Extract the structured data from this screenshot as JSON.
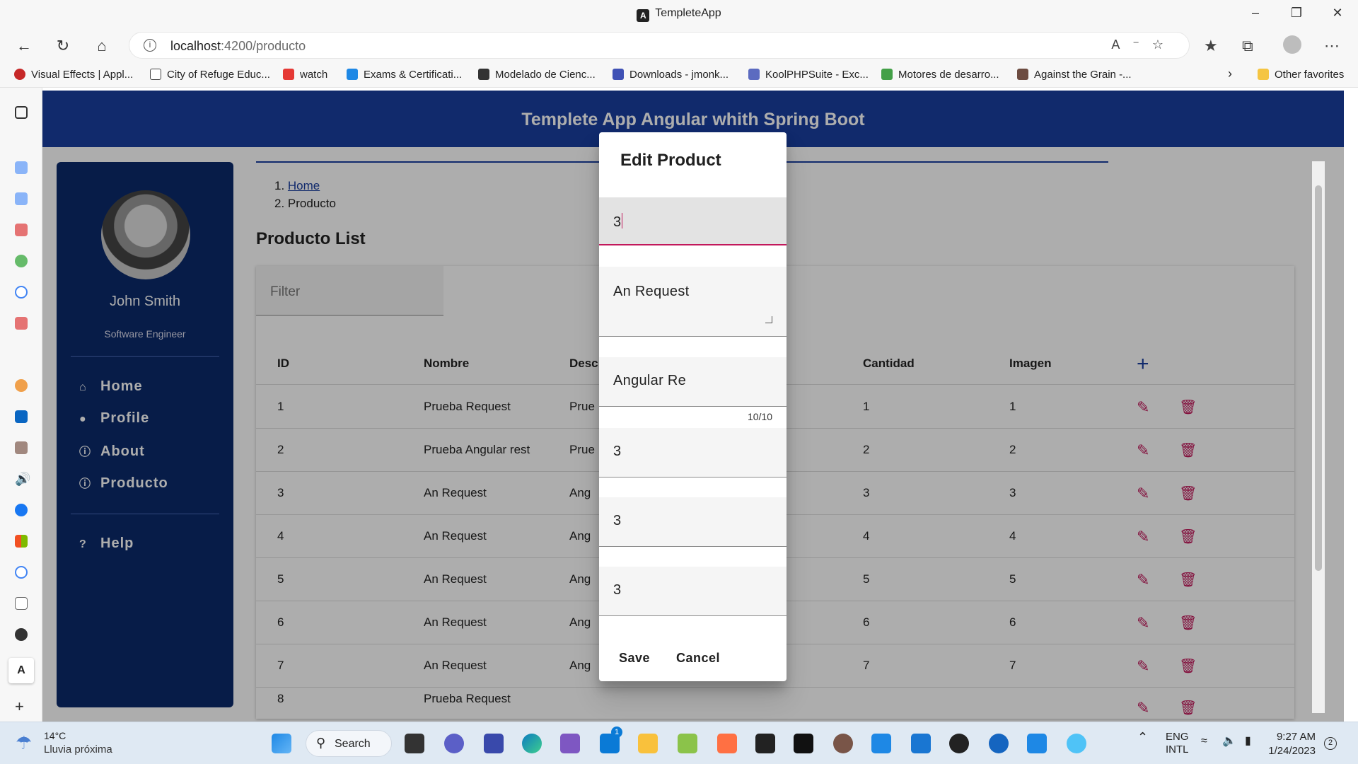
{
  "window": {
    "title": "TempleteApp"
  },
  "browser": {
    "url_host": "localhost",
    "url_rest": ":4200/producto",
    "favorites": [
      {
        "label": "Visual Effects | Appl...",
        "color": "#c62828"
      },
      {
        "label": "City of Refuge Educ...",
        "color": "#ffffff"
      },
      {
        "label": "watch",
        "color": "#e53935"
      },
      {
        "label": "Exams & Certificati...",
        "color": "#1e88e5"
      },
      {
        "label": "Modelado de Cienc...",
        "color": "#333333"
      },
      {
        "label": "Downloads - jmonk...",
        "color": "#3f51b5"
      },
      {
        "label": "KoolPHPSuite - Exc...",
        "color": "#5c6bc0"
      },
      {
        "label": "Motores de desarro...",
        "color": "#43a047"
      },
      {
        "label": "Against the Grain -...",
        "color": "#6d4c41"
      }
    ],
    "other_favorites": "Other favorites"
  },
  "app": {
    "header_title": "Templete App Angular whith Spring Boot",
    "user": {
      "name": "John Smith",
      "role": "Software Engineer"
    },
    "nav": [
      {
        "label": "Home",
        "icon": "home-icon"
      },
      {
        "label": "Profile",
        "icon": "person-icon"
      },
      {
        "label": "About",
        "icon": "info-icon"
      },
      {
        "label": "Producto",
        "icon": "info-icon"
      }
    ],
    "help_label": "Help",
    "breadcrumb": [
      "Home",
      "Producto"
    ],
    "page_title": "Producto List",
    "filter_placeholder": "Filter",
    "columns": [
      "ID",
      "Nombre",
      "Desc",
      "Cantidad",
      "Imagen"
    ],
    "rows": [
      {
        "id": "1",
        "nombre": "Prueba Request",
        "desc": "Prue",
        "cantidad": "1",
        "imagen": "1"
      },
      {
        "id": "2",
        "nombre": "Prueba Angular rest",
        "desc": "Prue",
        "cantidad": "2",
        "imagen": "2"
      },
      {
        "id": "3",
        "nombre": "An Request",
        "desc": "Ang",
        "cantidad": "3",
        "imagen": "3"
      },
      {
        "id": "4",
        "nombre": "An Request",
        "desc": "Ang",
        "cantidad": "4",
        "imagen": "4"
      },
      {
        "id": "5",
        "nombre": "An Request",
        "desc": "Ang",
        "cantidad": "5",
        "imagen": "5"
      },
      {
        "id": "6",
        "nombre": "An Request",
        "desc": "Ang",
        "cantidad": "6",
        "imagen": "6"
      },
      {
        "id": "7",
        "nombre": "An Request",
        "desc": "Ang",
        "cantidad": "7",
        "imagen": "7"
      },
      {
        "id": "8",
        "nombre": "Prueba Request",
        "desc": "",
        "cantidad": "",
        "imagen": ""
      }
    ]
  },
  "dialog": {
    "title": "Edit Product",
    "fields": {
      "id_value": "3",
      "nombre_value": "An Request",
      "descripcion_value": "Angular Re",
      "descripcion_counter": "10/10",
      "field4_value": "3",
      "field5_value": "3",
      "field6_value": "3"
    },
    "save_label": "Save",
    "cancel_label": "Cancel"
  },
  "taskbar": {
    "temp": "14°C",
    "condition": "Lluvia próxima",
    "search_label": "Search",
    "lang_top": "ENG",
    "lang_bottom": "INTL",
    "time": "9:27 AM",
    "date": "1/24/2023",
    "badge": "2",
    "mail_badge": "1"
  },
  "colors": {
    "accent": "#c2185b",
    "primary": "#1a3fa0",
    "sidenav": "#0b2a6b"
  }
}
